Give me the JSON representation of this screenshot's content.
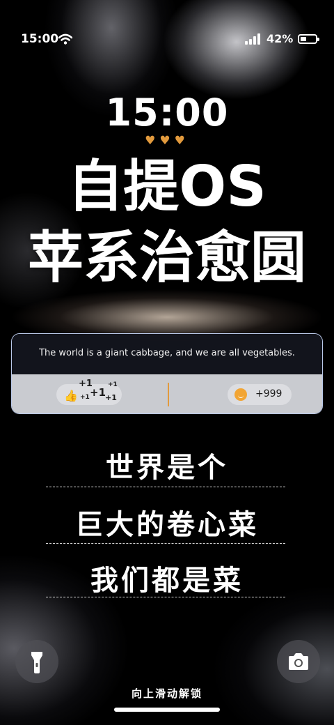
{
  "status_bar": {
    "time": "15:00",
    "battery_percent": "42%",
    "battery_level": 0.42
  },
  "lock": {
    "clock": "15:00",
    "hearts": "♥♥♥",
    "title_line1": "自提OS",
    "title_line2": "苹系治愈圆"
  },
  "card": {
    "quote": "The world is a giant cabbage, and we are all vegetables.",
    "like_icon": "👍",
    "plus_labels": [
      "+1",
      "+1",
      "+1",
      "+1",
      "+1"
    ],
    "comment_count": "+999"
  },
  "lyrics": {
    "line1": "世界是个",
    "line2": "巨大的卷心菜",
    "line3": "我们都是菜"
  },
  "bottom": {
    "unlock_hint": "向上滑动解锁"
  },
  "colors": {
    "accent": "#e29a3d",
    "card_border": "#b9c8e8"
  },
  "icons": [
    "wifi-icon",
    "cellular-signal-icon",
    "battery-icon",
    "thumbs-up-icon",
    "comment-icon",
    "flashlight-icon",
    "camera-icon"
  ]
}
